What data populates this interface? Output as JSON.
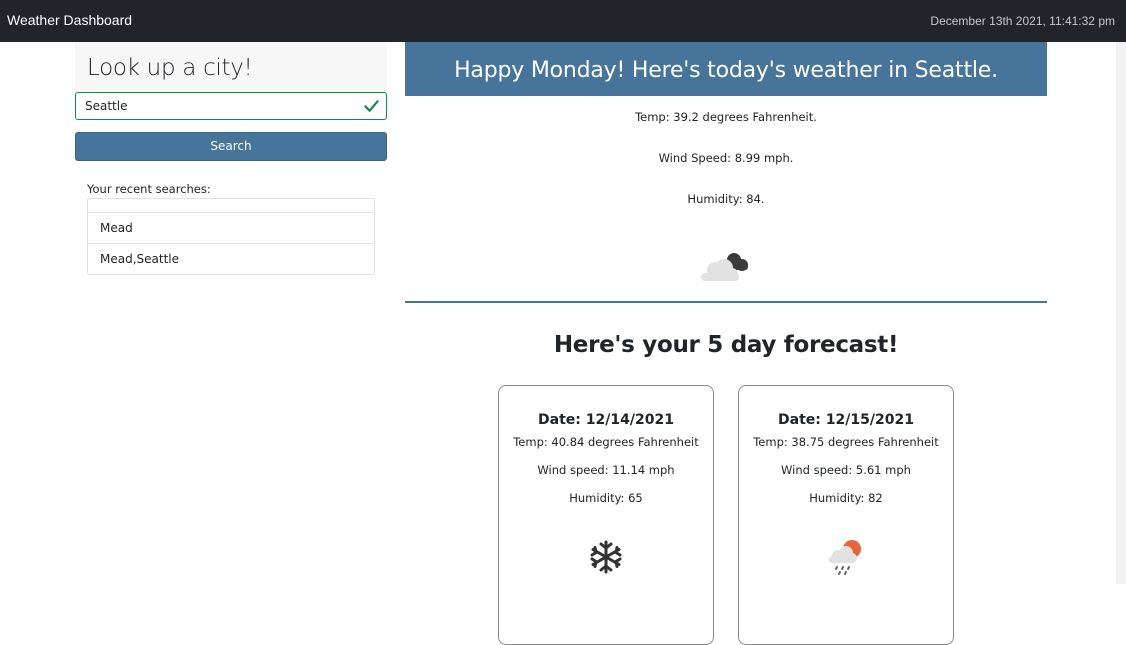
{
  "header": {
    "brand": "Weather Dashboard",
    "datetime": "December 13th 2021, 11:41:32 pm"
  },
  "sidebar": {
    "title": "Look up a city!",
    "input_value": "Seattle",
    "search_label": "Search",
    "recent_label": "Your recent searches:",
    "recent_items": [
      "",
      "Mead",
      "Mead,Seattle"
    ]
  },
  "today": {
    "banner": "Happy Monday! Here's today's weather in Seattle.",
    "temp": "Temp: 39.2 degrees Fahrenheit.",
    "wind": "Wind Speed: 8.99 mph.",
    "humidity": "Humidity: 84.",
    "icon": "cloudy-icon"
  },
  "forecast": {
    "title": "Here's your 5 day forecast!",
    "days": [
      {
        "date": "Date: 12/14/2021",
        "temp": "Temp: 40.84 degrees Fahrenheit",
        "wind": "Wind speed: 11.14 mph",
        "humidity": "Humidity: 65",
        "icon": "snowflake-icon"
      },
      {
        "date": "Date: 12/15/2021",
        "temp": "Temp: 38.75 degrees Fahrenheit",
        "wind": "Wind speed: 5.61 mph",
        "humidity": "Humidity: 82",
        "icon": "rain-sun-icon"
      }
    ]
  },
  "colors": {
    "accent": "#46749a",
    "navbar": "#212529",
    "valid": "#198754",
    "sun": "#e8643a"
  }
}
